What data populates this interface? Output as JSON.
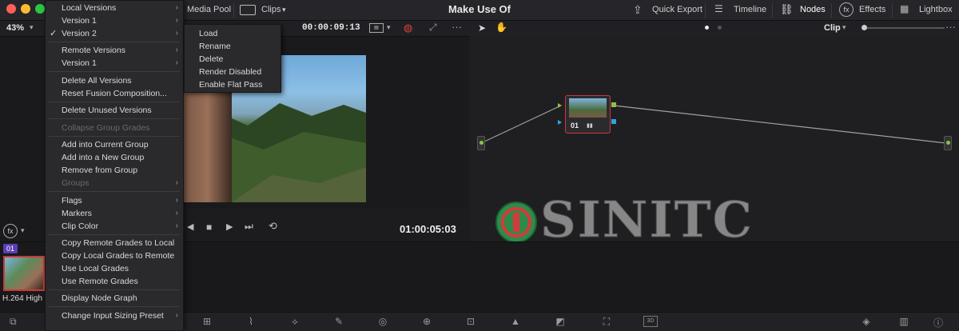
{
  "app": {
    "title": "Make Use Of",
    "zoom": "43%"
  },
  "topbar": {
    "media_pool": "Media Pool",
    "clips": "Clips",
    "quick_export": "Quick Export",
    "timeline": "Timeline",
    "nodes": "Nodes",
    "effects": "Effects",
    "lightbox": "Lightbox"
  },
  "viewer": {
    "timecode_top": "00:00:09:13",
    "timecode_bottom": "01:00:05:03"
  },
  "node_editor": {
    "mode": "Clip",
    "node_label": "01"
  },
  "clip": {
    "badge": "01",
    "name": "H.264 High"
  },
  "menu": {
    "items": [
      {
        "label": "Local Versions",
        "submenu": true
      },
      {
        "label": "Version 1",
        "submenu": true
      },
      {
        "label": "Version 2",
        "submenu": true,
        "checked": true
      },
      {
        "label": "Remote Versions",
        "submenu": true
      },
      {
        "label": "Version 1",
        "submenu": true
      },
      {
        "label": "Delete All Versions"
      },
      {
        "label": "Reset Fusion Composition..."
      },
      {
        "label": "Delete Unused Versions"
      },
      {
        "label": "Collapse Group Grades",
        "disabled": true
      },
      {
        "label": "Add into Current Group"
      },
      {
        "label": "Add into a New Group"
      },
      {
        "label": "Remove from Group"
      },
      {
        "label": "Groups",
        "submenu": true,
        "disabled": true
      },
      {
        "label": "Flags",
        "submenu": true
      },
      {
        "label": "Markers",
        "submenu": true
      },
      {
        "label": "Clip Color",
        "submenu": true
      },
      {
        "label": "Copy Remote Grades to Local"
      },
      {
        "label": "Copy Local Grades to Remote"
      },
      {
        "label": "Use Local Grades"
      },
      {
        "label": "Use Remote Grades"
      },
      {
        "label": "Display Node Graph"
      },
      {
        "label": "Change Input Sizing Preset",
        "submenu": true
      }
    ],
    "check_mark": "✓"
  },
  "submenu": {
    "items": [
      "Load",
      "Rename",
      "Delete",
      "Render Disabled",
      "Enable Flat Pass"
    ]
  },
  "watermark": {
    "text": "SINITC"
  },
  "colors": {
    "accent_red": "#c8383a",
    "node_green": "#8bc34a",
    "node_blue": "#2aa7e0",
    "traffic_red": "#ff5f57",
    "traffic_yellow": "#febc2e",
    "traffic_green": "#28c840"
  }
}
